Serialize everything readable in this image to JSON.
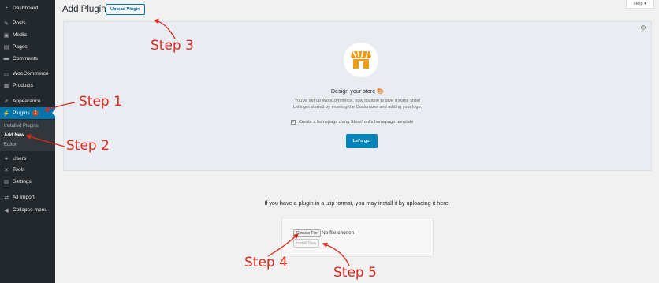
{
  "sidebar": {
    "items": [
      {
        "label": "Dashboard",
        "icon": "dashboard-icon",
        "glyph": "◔"
      },
      {
        "label": "Posts",
        "icon": "pin-icon",
        "glyph": "✎"
      },
      {
        "label": "Media",
        "icon": "media-icon",
        "glyph": "▣"
      },
      {
        "label": "Pages",
        "icon": "pages-icon",
        "glyph": "▤"
      },
      {
        "label": "Comments",
        "icon": "comments-icon",
        "glyph": "▬"
      },
      {
        "label": "WooCommerce",
        "icon": "woocommerce-icon",
        "glyph": "▭"
      },
      {
        "label": "Products",
        "icon": "products-icon",
        "glyph": "▦"
      },
      {
        "label": "Appearance",
        "icon": "appearance-icon",
        "glyph": "✐"
      },
      {
        "label": "Plugins",
        "icon": "plugins-icon",
        "glyph": "⚡",
        "badge": "1"
      },
      {
        "label": "Users",
        "icon": "users-icon",
        "glyph": "●"
      },
      {
        "label": "Tools",
        "icon": "tools-icon",
        "glyph": "✕"
      },
      {
        "label": "Settings",
        "icon": "settings-icon",
        "glyph": "▥"
      },
      {
        "label": "All Import",
        "icon": "all-import-icon",
        "glyph": "⇄"
      },
      {
        "label": "Collapse menu",
        "icon": "collapse-icon",
        "glyph": "◀"
      }
    ],
    "submenu": [
      "Installed Plugins",
      "Add New",
      "Editor"
    ]
  },
  "header": {
    "title": "Add Plugins",
    "upload_label": "Upload Plugin",
    "help_label": "Help ▾"
  },
  "storefront": {
    "title": "Design your store 🎨",
    "line1": "You've set up WooCommerce, now it's time to give it some style!",
    "line2": "Let's get started by entering the Customizer and adding your logo.",
    "checkbox_label": "Create a homepage using Storefront's homepage template",
    "checkbox_checked": true,
    "button_label": "Let's go!",
    "dismiss_icon": "close-circle-icon",
    "store_icon": "store-icon"
  },
  "upload": {
    "instruction": "If you have a plugin in a .zip format, you may install it by uploading it here.",
    "choose_file_label": "Choose File",
    "file_status": "No file chosen",
    "install_label": "Install Now"
  },
  "annotations": {
    "step1": "Step 1",
    "step2": "Step 2",
    "step3": "Step 3",
    "step4": "Step 4",
    "step5": "Step 5"
  },
  "colors": {
    "sidebar_bg": "#23282d",
    "accent": "#0073aa",
    "annotation": "#e0281d",
    "store_orange": "#f39c12"
  }
}
